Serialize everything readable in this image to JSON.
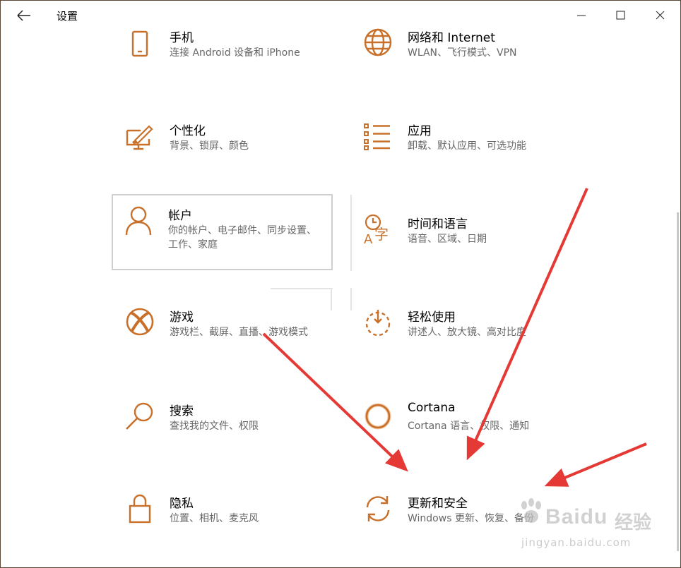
{
  "window": {
    "title": "设置",
    "accent_color": "#c8702a"
  },
  "tiles": [
    {
      "title": "手机",
      "desc": "连接 Android 设备和 iPhone",
      "icon": "phone-icon"
    },
    {
      "title": "网络和 Internet",
      "desc": "WLAN、飞行模式、VPN",
      "icon": "globe-icon"
    },
    {
      "title": "个性化",
      "desc": "背景、锁屏、颜色",
      "icon": "personalization-icon"
    },
    {
      "title": "应用",
      "desc": "卸载、默认应用、可选功能",
      "icon": "apps-list-icon"
    },
    {
      "title": "帐户",
      "desc": "你的帐户、电子邮件、同步设置、工作、家庭",
      "icon": "person-icon"
    },
    {
      "title": "时间和语言",
      "desc": "语音、区域、日期",
      "icon": "time-language-icon"
    },
    {
      "title": "游戏",
      "desc": "游戏栏、截屏、直播、游戏模式",
      "icon": "xbox-icon"
    },
    {
      "title": "轻松使用",
      "desc": "讲述人、放大镜、高对比度",
      "icon": "ease-of-access-icon"
    },
    {
      "title": "搜索",
      "desc": "查找我的文件、权限",
      "icon": "search-icon"
    },
    {
      "title": "Cortana",
      "desc": "Cortana 语言、权限、通知",
      "icon": "cortana-icon"
    },
    {
      "title": "隐私",
      "desc": "位置、相机、麦克风",
      "icon": "lock-icon"
    },
    {
      "title": "更新和安全",
      "desc": "Windows 更新、恢复、备份",
      "icon": "sync-icon"
    }
  ],
  "watermark": {
    "brand": "Baidu",
    "brand_cn": "经验",
    "url": "jingyan.baidu.com"
  },
  "annotation": {
    "arrow_color": "#e53935"
  }
}
